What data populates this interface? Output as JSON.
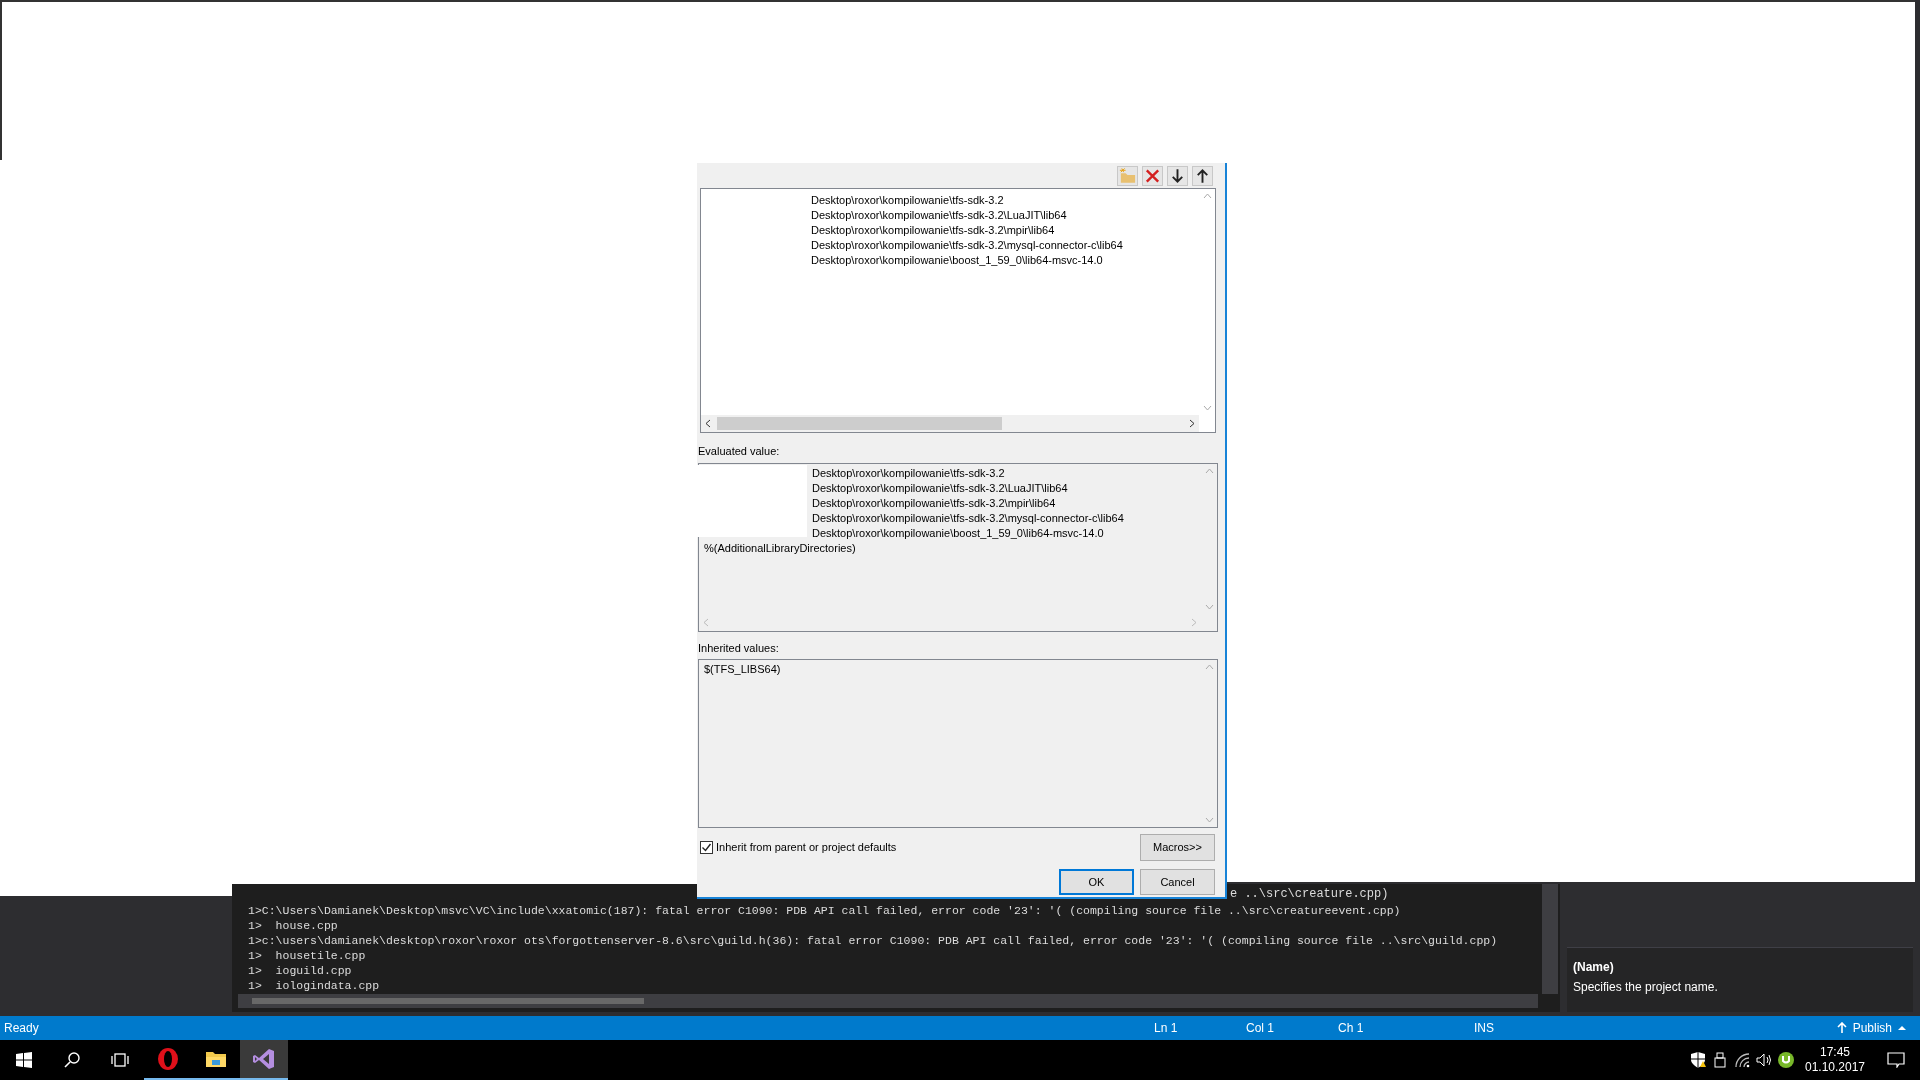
{
  "directories_list": {
    "lines": [
      "Desktop\\roxor\\kompilowanie\\tfs-sdk-3.2",
      "Desktop\\roxor\\kompilowanie\\tfs-sdk-3.2\\LuaJIT\\lib64",
      "Desktop\\roxor\\kompilowanie\\tfs-sdk-3.2\\mpir\\lib64",
      "Desktop\\roxor\\kompilowanie\\tfs-sdk-3.2\\mysql-connector-c\\lib64",
      "Desktop\\roxor\\kompilowanie\\boost_1_59_0\\lib64-msvc-14.0"
    ]
  },
  "evaluated": {
    "label": "Evaluated value:",
    "lines": [
      "Desktop\\roxor\\kompilowanie\\tfs-sdk-3.2",
      "Desktop\\roxor\\kompilowanie\\tfs-sdk-3.2\\LuaJIT\\lib64",
      "Desktop\\roxor\\kompilowanie\\tfs-sdk-3.2\\mpir\\lib64",
      "Desktop\\roxor\\kompilowanie\\tfs-sdk-3.2\\mysql-connector-c\\lib64",
      "Desktop\\roxor\\kompilowanie\\boost_1_59_0\\lib64-msvc-14.0"
    ],
    "extra_line": "%(AdditionalLibraryDirectories)"
  },
  "inherited": {
    "label": "Inherited values:",
    "lines": [
      "$(TFS_LIBS64)"
    ]
  },
  "inherit_checkbox": {
    "label": "Inherit from parent or project defaults",
    "checked": true
  },
  "buttons": {
    "macros": "Macros>>",
    "ok": "OK",
    "cancel": "Cancel"
  },
  "output": {
    "first_line_tail": "e ..\\src\\creature.cpp)",
    "lines": [
      "1>C:\\Users\\Damianek\\Desktop\\msvc\\VC\\include\\xxatomic(187): fatal error C1090: PDB API call failed, error code '23': '( (compiling source file ..\\src\\creatureevent.cpp)",
      "1>  house.cpp",
      "1>c:\\users\\damianek\\desktop\\roxor\\roxor ots\\forgottenserver-8.6\\src\\guild.h(36): fatal error C1090: PDB API call failed, error code '23': '( (compiling source file ..\\src\\guild.cpp)",
      "1>  housetile.cpp",
      "1>  ioguild.cpp",
      "1>  iologindata.cpp"
    ]
  },
  "properties_description": {
    "title": "(Name)",
    "text": "Specifies the project name."
  },
  "status_bar": {
    "left": "Ready",
    "items": [
      "Ln 1",
      "Col 1",
      "Ch 1",
      "INS"
    ],
    "publish": "Publish"
  },
  "taskbar": {
    "apps": [
      {
        "kind": "opera",
        "selected": false
      },
      {
        "kind": "explorer",
        "selected": false
      },
      {
        "kind": "visual-studio",
        "selected": true
      }
    ],
    "time": "17:45",
    "date": "01.10.2017"
  }
}
